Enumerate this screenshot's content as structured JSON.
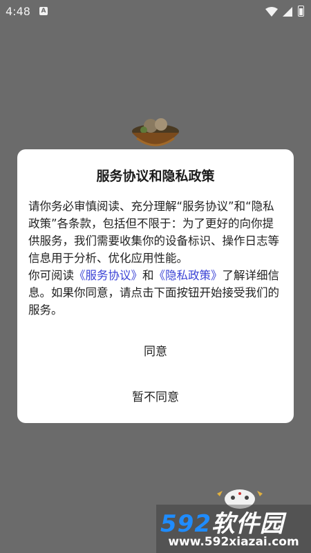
{
  "status": {
    "time": "4:48",
    "notification_icon": "A"
  },
  "dialog": {
    "title": "服务协议和隐私政策",
    "body_part1": "请你务必审慎阅读、充分理解“服务协议”和“隐私政策”各条款，包括但不限于：为了更好的向你提供服务，我们需要收集你的设备标识、操作日志等信息用于分析、优化应用性能。",
    "body_part2_prefix": "你可阅读",
    "service_link": "《服务协议》",
    "and_text": "和",
    "privacy_link": "《隐私政策》",
    "body_part2_suffix": "了解详细信息。如果你同意，请点击下面按钮开始接受我们的服务。",
    "agree_label": "同意",
    "disagree_label": "暂不同意"
  },
  "watermark": {
    "number": "592",
    "brand": "软件园",
    "url": "www.592xiazai.com"
  },
  "colors": {
    "overlay": "#6b6b6b",
    "link": "#3b43d6",
    "watermark_blue": "#1f8cff"
  }
}
